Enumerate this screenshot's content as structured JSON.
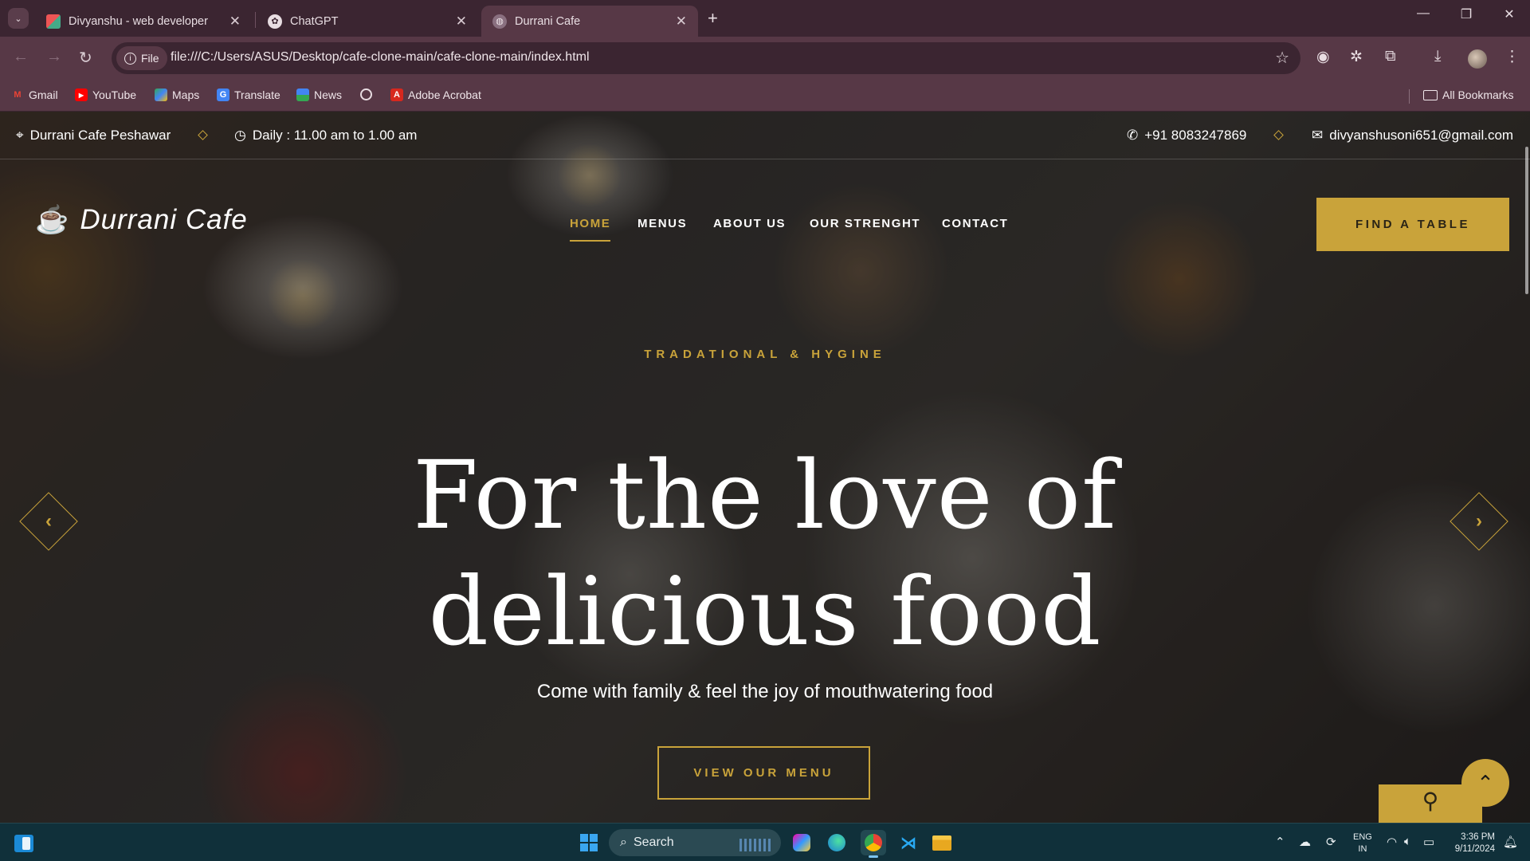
{
  "browser": {
    "tabs": [
      {
        "title": "Divyanshu - web developer",
        "close": "✕"
      },
      {
        "title": "ChatGPT",
        "close": "✕"
      },
      {
        "title": "Durrani Cafe",
        "close": "✕"
      }
    ],
    "new_tab": "+",
    "address": {
      "chip": "File",
      "url": "file:///C:/Users/ASUS/Desktop/cafe-clone-main/cafe-clone-main/index.html"
    },
    "bookmarks": [
      "Gmail",
      "YouTube",
      "Maps",
      "Translate",
      "News",
      "Adobe Acrobat"
    ],
    "all_bookmarks": "All Bookmarks"
  },
  "site": {
    "topbar": {
      "location": "Durrani Cafe Peshawar",
      "hours": "Daily : 11.00 am to 1.00 am",
      "phone": "+91 8083247869",
      "email": "divyanshusoni651@gmail.com"
    },
    "brand": "Durrani Cafe",
    "nav": [
      "HOME",
      "MENUS",
      "ABOUT US",
      "OUR STRENGHT",
      "CONTACT"
    ],
    "active_nav": "HOME",
    "cta": "FIND A TABLE",
    "hero": {
      "subtitle": "TRADATIONAL & HYGINE",
      "title_line1": "For the love of",
      "title_line2": "delicious food",
      "tagline": "Come with family & feel the joy of mouthwatering food",
      "button": "VIEW OUR MENU"
    },
    "colors": {
      "accent": "#c9a33a",
      "text": "#ffffff"
    }
  },
  "taskbar": {
    "search_label": "Search",
    "lang_line1": "ENG",
    "lang_line2": "IN",
    "time": "3:36 PM",
    "date": "9/11/2024"
  }
}
